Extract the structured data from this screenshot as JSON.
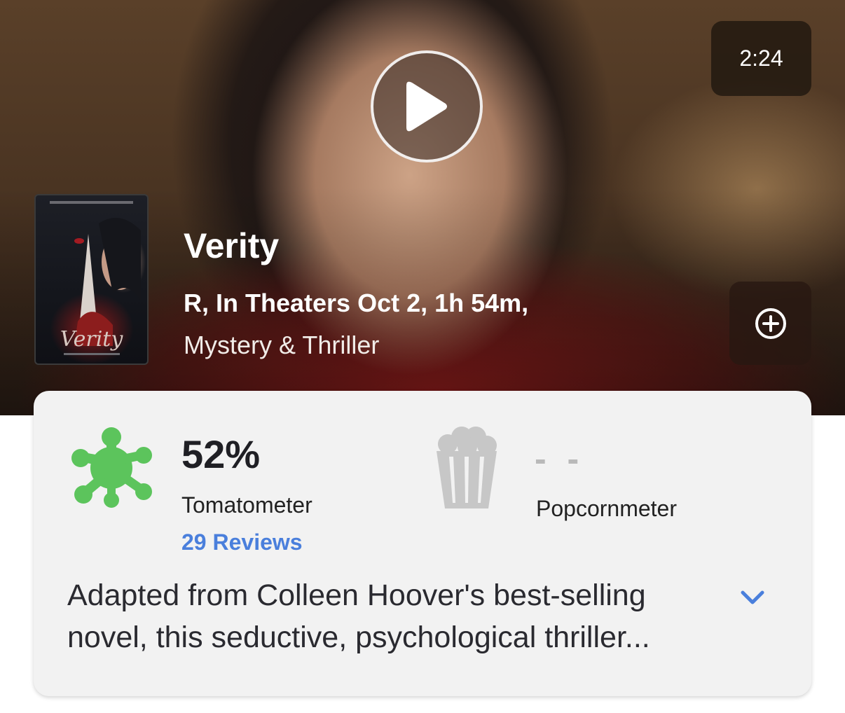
{
  "trailer": {
    "duration": "2:24",
    "play_icon": "play-icon"
  },
  "movie": {
    "poster_title": "Verity",
    "title": "Verity",
    "meta": "R, In Theaters Oct 2, 1h 54m,",
    "genre": "Mystery & Thriller",
    "add_icon": "plus-circle-icon"
  },
  "scores": {
    "tomatometer": {
      "value": "52%",
      "label": "Tomatometer",
      "reviews": "29 Reviews",
      "icon": "rotten-splat-icon",
      "color": "#5cc45c"
    },
    "popcornmeter": {
      "value": "- -",
      "label": "Popcornmeter",
      "icon": "popcorn-bucket-icon",
      "color": "#b9b9b9"
    },
    "link_color": "#4a7fdc"
  },
  "synopsis": {
    "line1": "Adapted from Colleen Hoover's best-selling",
    "line2": "novel, this seductive, psychological thriller...",
    "expand_icon": "chevron-down-icon"
  }
}
